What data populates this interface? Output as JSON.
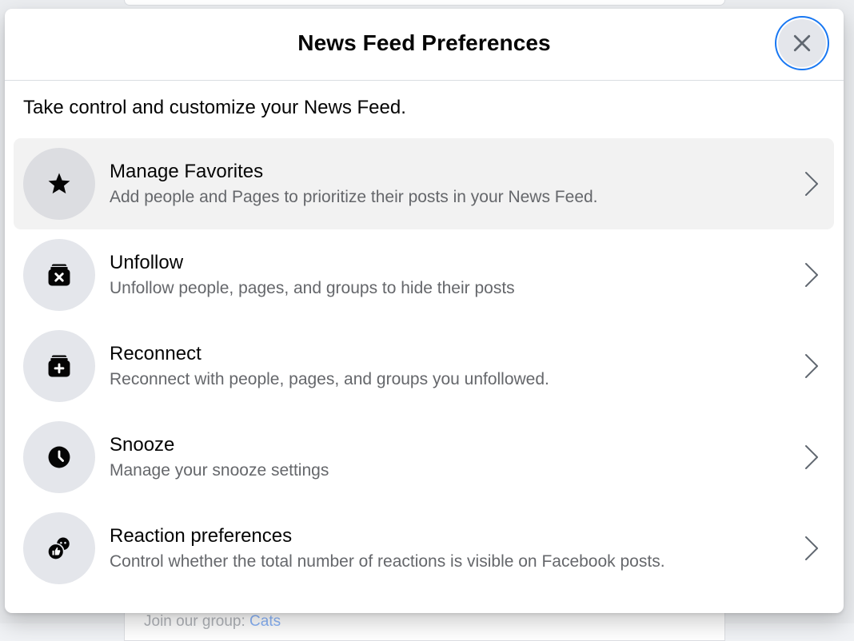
{
  "dialog": {
    "title": "News Feed Preferences",
    "close_icon": "close-icon",
    "subtitle": "Take control and customize your News Feed.",
    "accent_color": "#1877f2"
  },
  "items": [
    {
      "title": "Manage Favorites",
      "description": "Add people and Pages to prioritize their posts in your News Feed.",
      "icon": "star-icon",
      "highlighted": true
    },
    {
      "title": "Unfollow",
      "description": "Unfollow people, pages, and groups to hide their posts",
      "icon": "unfollow-icon",
      "highlighted": false
    },
    {
      "title": "Reconnect",
      "description": "Reconnect with people, pages, and groups you unfollowed.",
      "icon": "reconnect-icon",
      "highlighted": false
    },
    {
      "title": "Snooze",
      "description": "Manage your snooze settings",
      "icon": "clock-icon",
      "highlighted": false
    },
    {
      "title": "Reaction preferences",
      "description": "Control whether the total number of reactions is visible on Facebook posts.",
      "icon": "reaction-icon",
      "highlighted": false
    }
  ],
  "background": {
    "group_text": "Join our group: ",
    "group_link": "Cats"
  }
}
